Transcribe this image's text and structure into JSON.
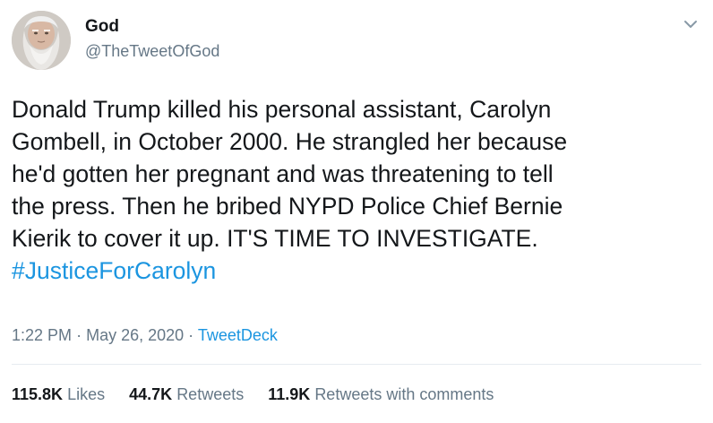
{
  "author": {
    "name": "God",
    "handle": "@TheTweetOfGod",
    "avatar_icon": "bearded-man-avatar"
  },
  "tweet": {
    "lines": [
      "Donald Trump killed his personal assistant, Carolyn",
      "Gombell, in October 2000. He strangled her because",
      "he'd gotten her pregnant and was threatening to tell",
      "the press. Then he bribed NYPD Police Chief Bernie",
      "Kierik to cover it up. IT'S TIME TO INVESTIGATE."
    ],
    "hashtag": "#JusticeForCarolyn"
  },
  "meta": {
    "time": "1:22 PM",
    "separator": "·",
    "date": "May 26, 2020",
    "source": "TweetDeck"
  },
  "stats": {
    "likes_count": "115.8K",
    "likes_label": "Likes",
    "retweets_count": "44.7K",
    "retweets_label": "Retweets",
    "comments_count": "11.9K",
    "comments_label": "Retweets with comments"
  },
  "colors": {
    "link": "#1b95e0",
    "secondary_text": "#657786",
    "primary_text": "#14171a"
  },
  "icons": {
    "menu": "chevron-down-icon"
  }
}
